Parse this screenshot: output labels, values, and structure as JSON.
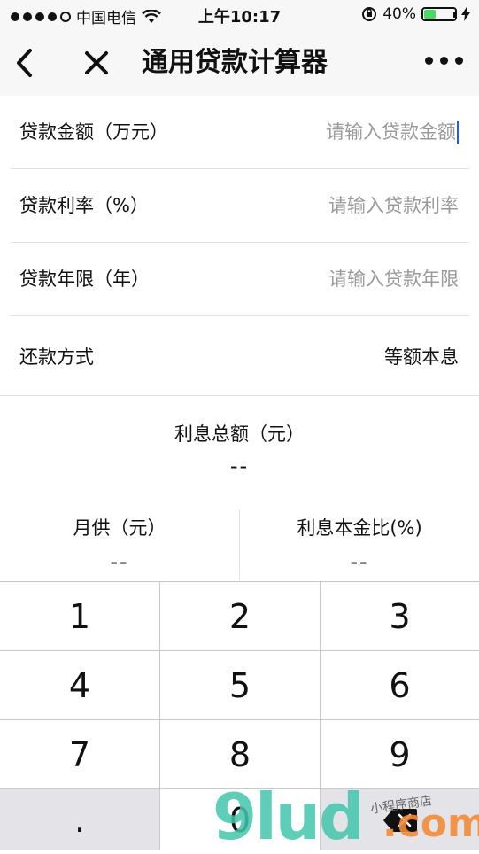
{
  "status_bar": {
    "carrier": "中国电信",
    "time": "上午10:17",
    "battery_percent": "40%",
    "battery_level": 0.4
  },
  "nav": {
    "title": "通用贷款计算器",
    "back_icon": "chevron-left-icon",
    "close_icon": "close-icon",
    "more_icon": "more-dots-icon"
  },
  "form": {
    "amount_label": "贷款金额（万元）",
    "amount_placeholder": "请输入贷款金额",
    "rate_label": "贷款利率（%）",
    "rate_placeholder": "请输入贷款利率",
    "years_label": "贷款年限（年）",
    "years_placeholder": "请输入贷款年限",
    "method_label": "还款方式",
    "method_value": "等额本息"
  },
  "results": {
    "total_interest_label": "利息总额（元）",
    "total_interest_value": "--",
    "monthly_label": "月供（元）",
    "monthly_value": "--",
    "ratio_label": "利息本金比(%)",
    "ratio_value": "--"
  },
  "keypad": {
    "keys": [
      "1",
      "2",
      "3",
      "4",
      "5",
      "6",
      "7",
      "8",
      "9",
      ".",
      "0"
    ],
    "delete_icon": "backspace-icon"
  },
  "watermark": {
    "brand": "9lud",
    "suffix": ".com",
    "tagline": "小程序商店"
  }
}
